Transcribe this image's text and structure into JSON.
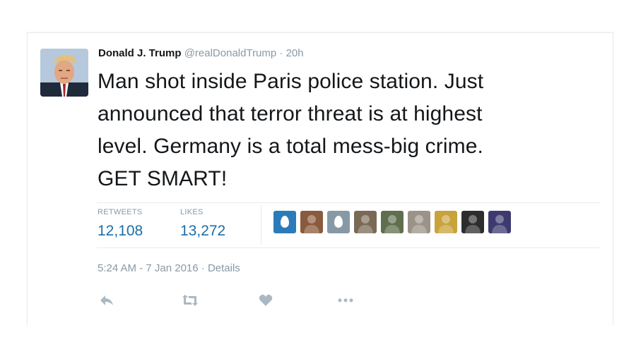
{
  "author": {
    "name": "Donald J. Trump",
    "handle": "@realDonaldTrump",
    "separator": "·",
    "time_ago": "20h"
  },
  "tweet": {
    "text": "Man shot inside Paris police station. Just\nannounced that terror threat is at highest\nlevel. Germany is a total mess-big crime.\nGET SMART!"
  },
  "stats": {
    "retweets_label": "RETWEETS",
    "retweets_value": "12,108",
    "likes_label": "LIKES",
    "likes_value": "13,272"
  },
  "likers": [
    {
      "icon": "egg-avatar",
      "color": "#2b7bb9"
    },
    {
      "icon": "user-avatar",
      "color": "#8a5a3c"
    },
    {
      "icon": "egg-avatar",
      "color": "#8899a6"
    },
    {
      "icon": "user-avatar",
      "color": "#7a6a55"
    },
    {
      "icon": "user-avatar",
      "color": "#5f6e4c"
    },
    {
      "icon": "user-avatar",
      "color": "#9b9387"
    },
    {
      "icon": "user-avatar",
      "color": "#c8a23b"
    },
    {
      "icon": "user-avatar",
      "color": "#2d2d2d"
    },
    {
      "icon": "user-avatar",
      "color": "#3c3a6e"
    }
  ],
  "meta": {
    "timestamp": "5:24 AM - 7 Jan 2016",
    "separator": "·",
    "details_label": "Details"
  },
  "actions": [
    {
      "name": "reply-icon"
    },
    {
      "name": "retweet-icon"
    },
    {
      "name": "like-icon"
    },
    {
      "name": "more-icon"
    }
  ],
  "colors": {
    "link_blue": "#1b6ea8",
    "muted_gray": "#8899a6",
    "action_gray": "#aab8c2"
  }
}
